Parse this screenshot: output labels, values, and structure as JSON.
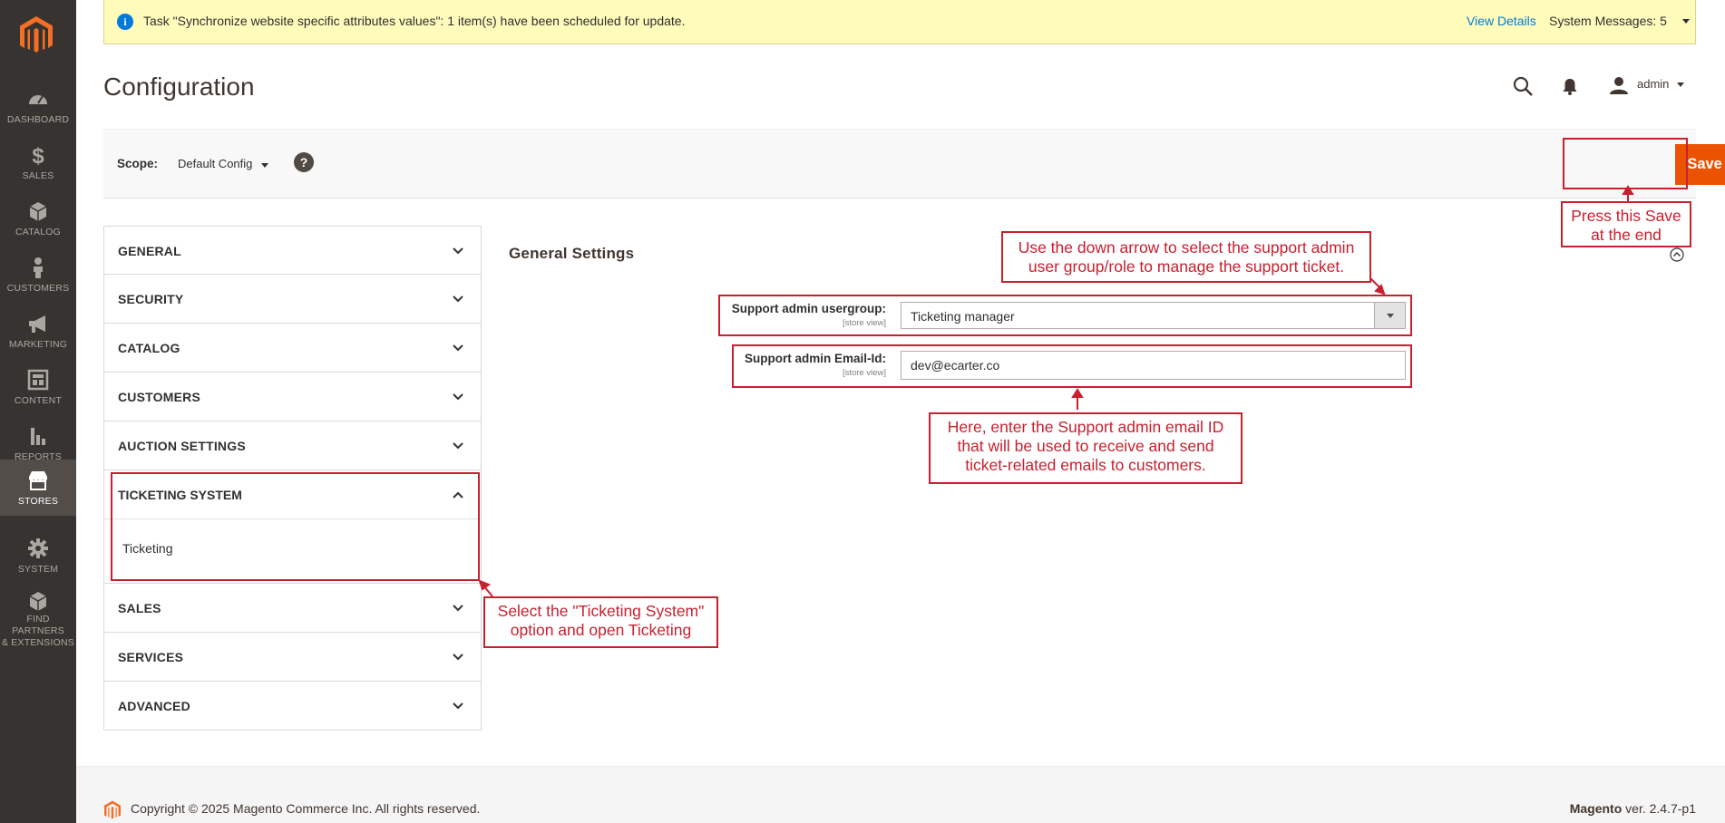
{
  "sidebar": {
    "items": [
      {
        "label": "DASHBOARD",
        "icon": "dashboard-icon"
      },
      {
        "label": "SALES",
        "icon": "dollar-icon"
      },
      {
        "label": "CATALOG",
        "icon": "box-icon"
      },
      {
        "label": "CUSTOMERS",
        "icon": "person-icon"
      },
      {
        "label": "MARKETING",
        "icon": "megaphone-icon"
      },
      {
        "label": "CONTENT",
        "icon": "layout-icon"
      },
      {
        "label": "REPORTS",
        "icon": "bar-chart-icon"
      },
      {
        "label": "STORES",
        "icon": "store-icon",
        "active": true
      },
      {
        "label": "SYSTEM",
        "icon": "gear-icon"
      },
      {
        "label": "FIND PARTNERS",
        "label2": "& EXTENSIONS",
        "icon": "cube-icon"
      }
    ]
  },
  "notice": {
    "message": "Task \"Synchronize website specific attributes values\": 1 item(s) have been scheduled for update.",
    "view_details": "View Details",
    "system_messages": "System Messages: 5"
  },
  "header": {
    "title": "Configuration",
    "user": "admin"
  },
  "scope": {
    "label": "Scope:",
    "value": "Default Config",
    "help": "?",
    "save_button": "Save Config"
  },
  "tabs": {
    "items": [
      "GENERAL",
      "SECURITY",
      "CATALOG",
      "CUSTOMERS",
      "AUCTION SETTINGS"
    ],
    "open": {
      "label": "TICKETING SYSTEM",
      "sub": "Ticketing"
    },
    "after": [
      "SALES",
      "SERVICES",
      "ADVANCED"
    ]
  },
  "section": {
    "title": "General Settings",
    "fields": [
      {
        "label": "Support admin usergroup:",
        "scope": "[store view]",
        "value": "Ticketing manager"
      },
      {
        "label": "Support admin Email-Id:",
        "scope": "[store view]",
        "value": "dev@ecarter.co"
      }
    ]
  },
  "annotations": {
    "save": "Press this Save\nat the end",
    "usergroup": "Use the down arrow to select the support admin\nuser group/role to manage the support ticket.",
    "email": "Here, enter the Support admin email ID\nthat will be used to receive and send\nticket-related emails to customers.",
    "ticketing": "Select the \"Ticketing System\"\noption and open Ticketing"
  },
  "footer": {
    "copyright": "Copyright © 2025 Magento Commerce Inc. All rights reserved.",
    "brand": "Magento",
    "version": " ver. 2.4.7-p1"
  },
  "colors": {
    "sidebar": "#373330",
    "accent": "#eb5202",
    "annotation": "#c8202f",
    "notice_bg": "#fffbbb",
    "link": "#007bdb"
  }
}
